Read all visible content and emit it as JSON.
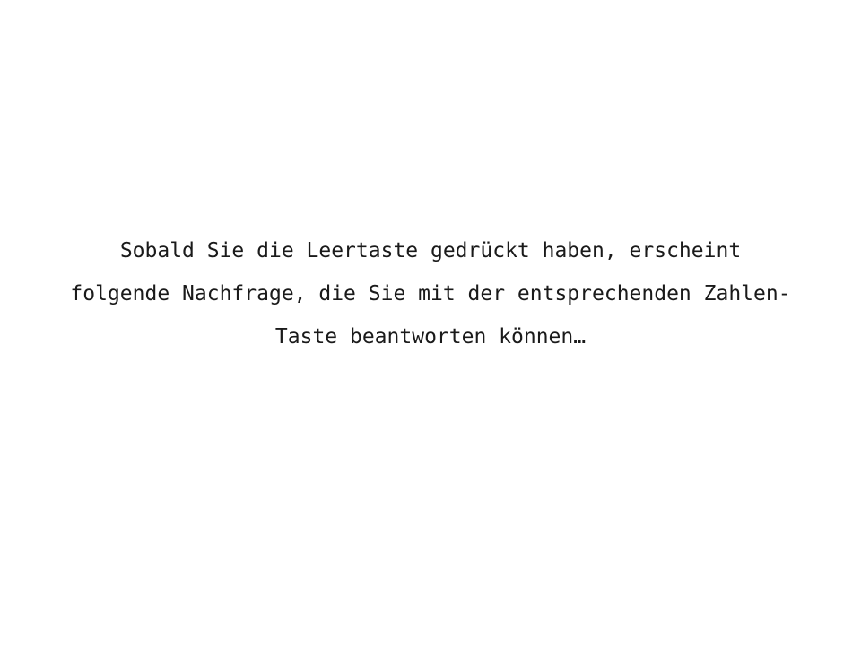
{
  "instruction": {
    "lines": [
      "Sobald Sie die Leertaste gedrückt haben, erscheint",
      "folgende Nachfrage, die Sie mit der entsprechenden Zahlen-",
      "Taste beantworten können…"
    ]
  }
}
